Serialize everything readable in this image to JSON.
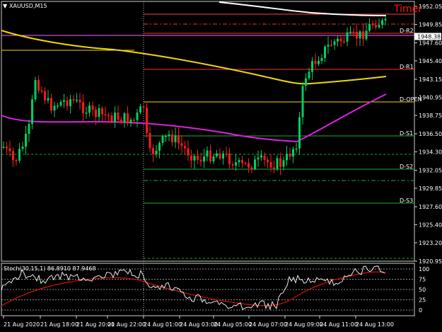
{
  "window": {
    "symbol_label": "XAUUSD,M15",
    "timer_label": "Timer"
  },
  "price_axis": {
    "ticks": [
      "1952.05",
      "1949.85",
      "1947.60",
      "1945.40",
      "1943.15",
      "1940.95",
      "1938.75",
      "1936.50",
      "1934.30",
      "1932.05",
      "1929.85",
      "1927.60",
      "1925.40",
      "1923.20",
      "1920.95"
    ]
  },
  "current_price": "1948.38",
  "levels": [
    {
      "name": "D-R2"
    },
    {
      "name": "D-R1"
    },
    {
      "name": "D-OPEN"
    },
    {
      "name": "D-S1"
    },
    {
      "name": "D-S2"
    },
    {
      "name": "D-S3"
    }
  ],
  "stoch": {
    "label": "Stoch(30,15,1) 86.8910 87.9468",
    "ticks": [
      "100",
      "75",
      "50",
      "25",
      "0"
    ]
  },
  "time_axis": [
    "21 Aug 2020",
    "21 Aug 18:00",
    "21 Aug 20:00",
    "21 Aug 22:00",
    "24 Aug 01:00",
    "24 Aug 03:00",
    "24 Aug 05:00",
    "24 Aug 07:00",
    "24 Aug 09:00",
    "24 Aug 11:00",
    "24 Aug 13:00"
  ],
  "colors": {
    "bull": "#00d060",
    "bear": "#ff1a1a",
    "ma_yellow": "#f2d60a",
    "ma_magenta": "#e020e0",
    "ma_white": "#ffffff",
    "stoch_main": "#ffffff",
    "stoch_signal": "#d01010"
  }
}
